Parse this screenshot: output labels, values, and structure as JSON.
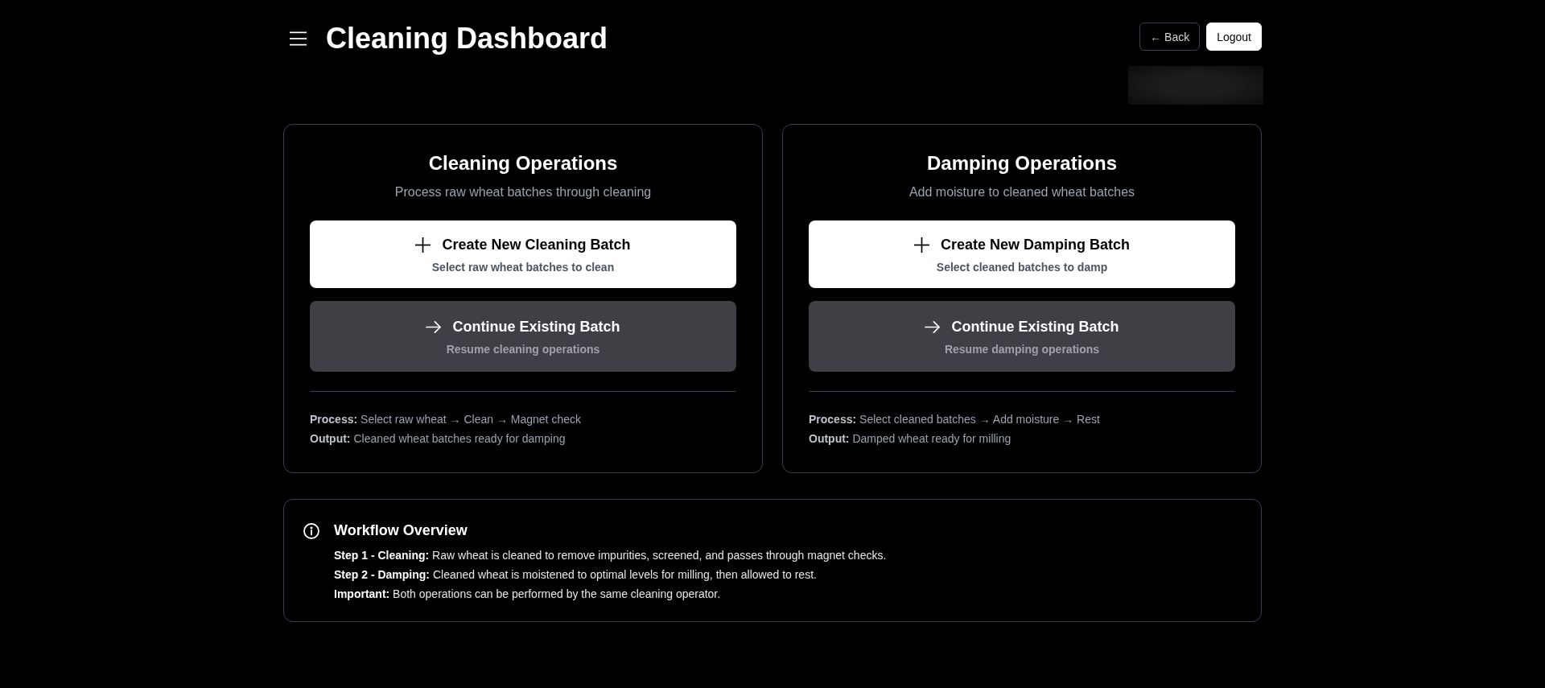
{
  "header": {
    "title": "Cleaning Dashboard",
    "buttons": [
      {
        "label": "← Back",
        "kind": "back"
      },
      {
        "label": "Logout",
        "kind": "logout"
      }
    ]
  },
  "cards": [
    {
      "title": "Cleaning Operations",
      "subtitle": "Process raw wheat batches through cleaning",
      "actions": [
        {
          "kind": "create",
          "title": "Create New Cleaning Batch",
          "subtitle": "Select raw wheat batches to clean"
        },
        {
          "kind": "continue",
          "title": "Continue Existing Batch",
          "subtitle": "Resume cleaning operations"
        }
      ],
      "details": [
        "**Process:** Select raw wheat → Clean → Magnet check",
        "**Output:** Cleaned wheat batches ready for damping"
      ]
    },
    {
      "title": "Damping Operations",
      "subtitle": "Add moisture to cleaned wheat batches",
      "actions": [
        {
          "kind": "create",
          "title": "Create New Damping Batch",
          "subtitle": "Select cleaned batches to damp"
        },
        {
          "kind": "continue",
          "title": "Continue Existing Batch",
          "subtitle": "Resume damping operations"
        }
      ],
      "details": [
        "**Process:** Select cleaned batches → Add moisture → Rest",
        "**Output:** Damped wheat ready for milling"
      ]
    }
  ],
  "workflow": {
    "title": "Workflow Overview",
    "steps": [
      "**Step 1 - Cleaning:** Raw wheat is cleaned to remove impurities, screened, and passes through magnet checks.",
      "**Step 2 - Damping:** Cleaned wheat is moistened to optimal levels for milling, then allowed to rest.",
      "**Important:** Both operations can be performed by the same cleaning operator."
    ]
  }
}
